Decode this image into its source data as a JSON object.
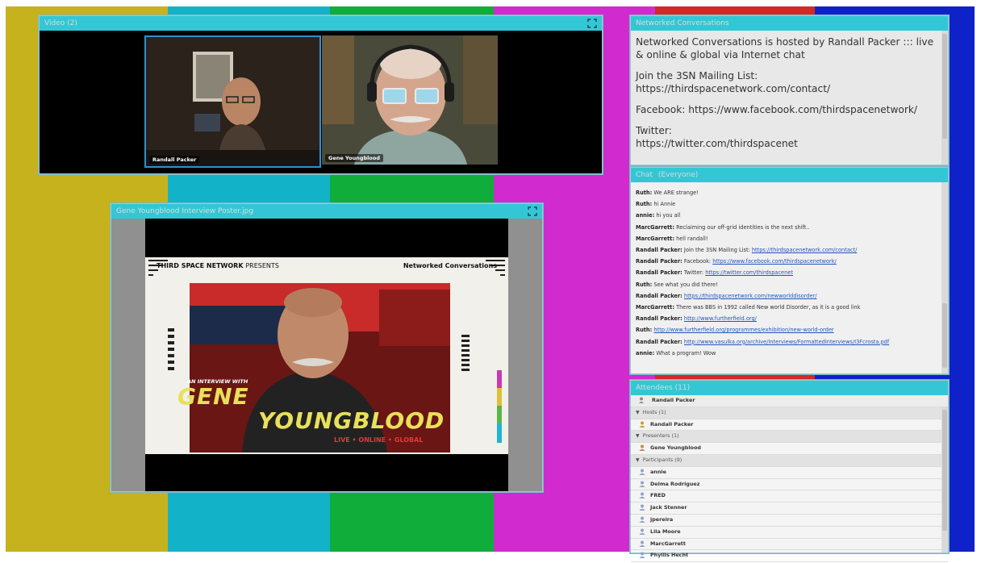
{
  "colors": {
    "bars": [
      "#c6b21c",
      "#12b3c9",
      "#11ad3b",
      "#d12bcf",
      "#d52724",
      "#0f22c9"
    ],
    "pod_title": "#33c7d6",
    "host_camera_border": "#2f8fd0",
    "link": "#2255bb"
  },
  "video_pod": {
    "title": "Video (2)",
    "cams": [
      {
        "label": "Randall Packer"
      },
      {
        "label": "Gene Youngblood"
      }
    ]
  },
  "share_pod": {
    "title": "Gene Youngblood Interview Poster.jpg",
    "poster": {
      "header_left_bold": "THIRD SPACE NETWORK",
      "header_left_light": "PRESENTS",
      "header_right": "Networked Conversations",
      "kicker": "AN INTERVIEW WITH",
      "name_line1": "GENE",
      "name_line2": "YOUNGBLOOD",
      "tagline": "LIVE • ONLINE • GLOBAL"
    }
  },
  "notes_pod": {
    "title": "Networked Conversations",
    "paragraphs": [
      "Networked Conversations is hosted by Randall Packer ::: live & online & global via Internet chat",
      "Join the 3SN Mailing List: https://thirdspacenetwork.com/contact/",
      "Facebook: https://www.facebook.com/thirdspacenetwork/",
      "Twitter:\nhttps://twitter.com/thirdspacenet"
    ]
  },
  "chat_pod": {
    "title": "Chat",
    "subtitle": "(Everyone)",
    "messages": [
      {
        "from": "Ruth:",
        "text": "We ARE strange!",
        "link": ""
      },
      {
        "from": "Ruth:",
        "text": "hi Annie",
        "link": ""
      },
      {
        "from": "annie:",
        "text": "hi you all",
        "link": ""
      },
      {
        "from": "MarcGarrett:",
        "text": "Reclaiming our off-grid identities is the next shift..",
        "link": ""
      },
      {
        "from": "MarcGarrett:",
        "text": "hell randall!",
        "link": ""
      },
      {
        "from": "Randall Packer:",
        "text": "Join the 3SN Mailing List: ",
        "link": "https://thirdspacenetwork.com/contact/"
      },
      {
        "from": "Randall Packer:",
        "text": "Facebook: ",
        "link": "https://www.facebook.com/thirdspacenetwork/"
      },
      {
        "from": "Randall Packer:",
        "text": "Twitter: ",
        "link": "https://twitter.com/thirdspacenet"
      },
      {
        "from": "Ruth:",
        "text": "See what you did there!",
        "link": ""
      },
      {
        "from": "Randall Packer:",
        "text": "",
        "link": "https://thirdspacenetwork.com/newworlddisorder/"
      },
      {
        "from": "MarcGarrett:",
        "text": "There was BBS in 1992 called New world Disorder, as it is a good link",
        "link": ""
      },
      {
        "from": "Randall Packer:",
        "text": "",
        "link": "http://www.furtherfield.org/"
      },
      {
        "from": "Ruth:",
        "text": "",
        "link": "http://www.furtherfield.org/programmes/exhibition/new-world-order"
      },
      {
        "from": "Randall Packer:",
        "text": "",
        "link": "http://www.vasulka.org/archive/Interviews/FormattedInterviews/I3Fcrosta.pdf"
      },
      {
        "from": "annie:",
        "text": "What a program! Wow",
        "link": ""
      }
    ]
  },
  "attendees_pod": {
    "title": "Attendees (11)",
    "me": "Randall Packer",
    "groups": [
      {
        "label": "Hosts (1)",
        "people": [
          "Randall Packer"
        ]
      },
      {
        "label": "Presenters (1)",
        "people": [
          "Gene Youngblood"
        ]
      },
      {
        "label": "Participants (9)",
        "people": [
          "annie",
          "Delma Rodriguez",
          "FRED",
          "Jack Stenner",
          "jpereira",
          "Lila Moore",
          "MarcGarrett",
          "Phyllis Hecht"
        ]
      }
    ]
  }
}
